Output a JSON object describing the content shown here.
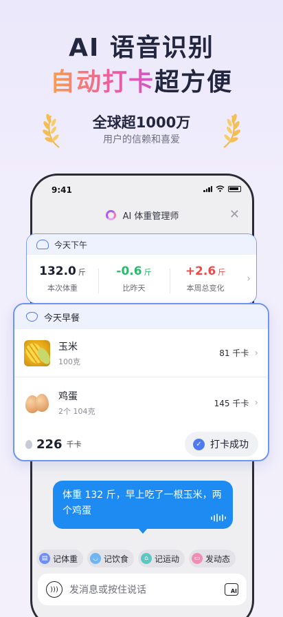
{
  "hero": {
    "line1": "AI 语音识别",
    "line2_highlight": "自动打卡",
    "line2_rest": "超方便",
    "stat_main": "全球超1000万",
    "stat_sub": "用户的信赖和喜爱"
  },
  "status_bar": {
    "time": "9:41"
  },
  "app_header": {
    "title": "AI 体重管理师",
    "close": "✕"
  },
  "weight_card": {
    "title": "今天下午",
    "stats": [
      {
        "value": "132.0",
        "unit": "斤",
        "label": "本次体重",
        "tone": "neutral"
      },
      {
        "value": "-0.6",
        "unit": "斤",
        "label": "比昨天",
        "tone": "green"
      },
      {
        "value": "+2.6",
        "unit": "斤",
        "label": "本周总变化",
        "tone": "red"
      }
    ]
  },
  "meal_card": {
    "title": "今天早餐",
    "items": [
      {
        "name": "玉米",
        "qty": "100克",
        "kcal": "81 千卡"
      },
      {
        "name": "鸡蛋",
        "qty": "2个 104克",
        "kcal": "145 千卡"
      }
    ],
    "total_kcal": "226",
    "total_unit": "千卡",
    "checkin_label": "打卡成功"
  },
  "chat": {
    "message": "体重 132 斤，早上吃了一根玉米，两个鸡蛋"
  },
  "quick_actions": [
    {
      "label": "记体重",
      "color": "#6f8ef2"
    },
    {
      "label": "记饮食",
      "color": "#6fb5f2"
    },
    {
      "label": "记运动",
      "color": "#5cc6c0"
    },
    {
      "label": "发动态",
      "color": "#f08db6"
    }
  ],
  "input": {
    "placeholder": "发消息或按住说话",
    "camera_badge": "AI"
  },
  "colors": {
    "accent": "#4f79ef",
    "bubble": "#1e8bf2",
    "positive": "#2cb96b",
    "negative": "#ef4a4a"
  }
}
